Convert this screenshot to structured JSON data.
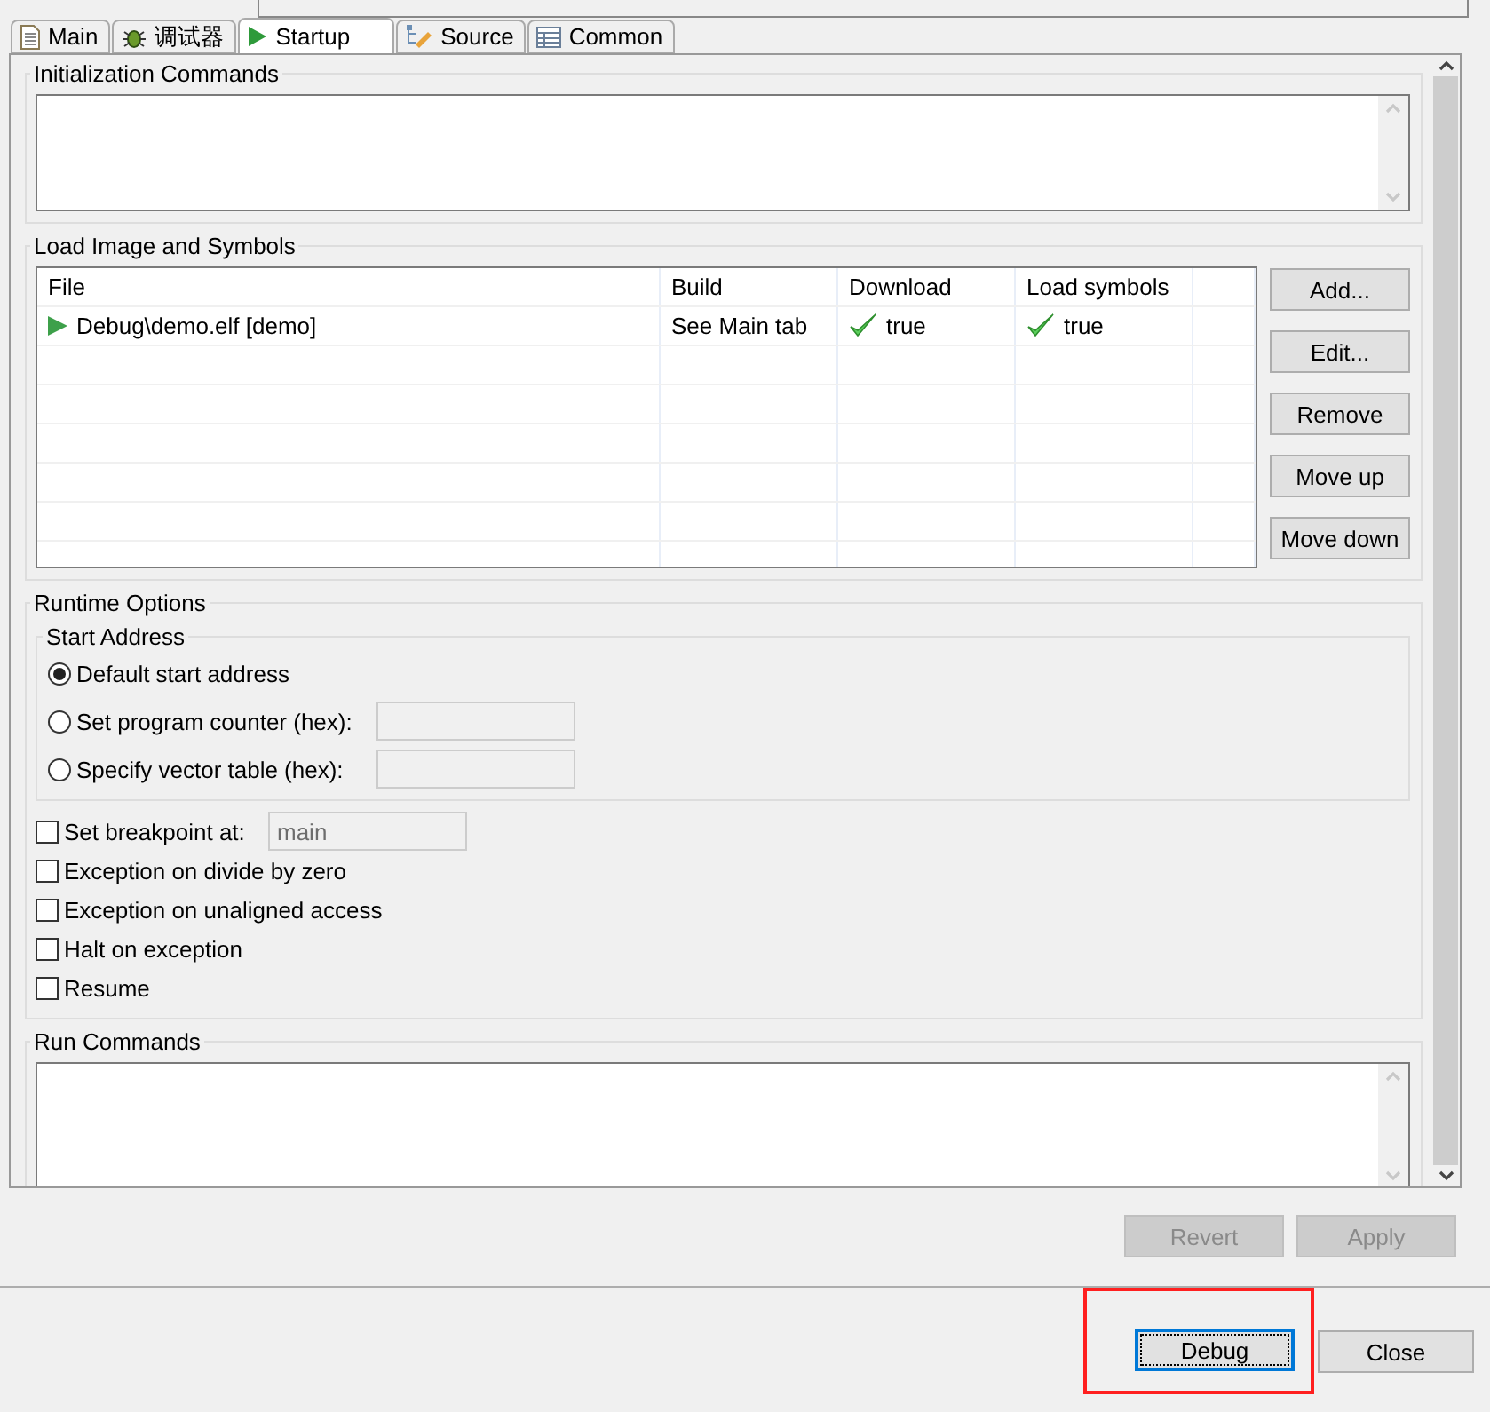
{
  "tabs": [
    {
      "label": "Main",
      "kind": "document",
      "selected": false
    },
    {
      "label": "调试器",
      "kind": "bug",
      "selected": false
    },
    {
      "label": "Startup",
      "kind": "play",
      "selected": true
    },
    {
      "label": "Source",
      "kind": "tree",
      "selected": false
    },
    {
      "label": "Common",
      "kind": "table",
      "selected": false
    }
  ],
  "init_commands": {
    "title": "Initialization Commands"
  },
  "load_image": {
    "title": "Load Image and Symbols",
    "columns": [
      "File",
      "Build",
      "Download",
      "Load symbols"
    ],
    "rows": [
      {
        "file": "Debug\\demo.elf [demo]",
        "build": "See Main tab",
        "download": "true",
        "load_symbols": "true"
      }
    ],
    "buttons": [
      "Add...",
      "Edit...",
      "Remove",
      "Move up",
      "Move down"
    ]
  },
  "runtime": {
    "title": "Runtime Options",
    "start_address": {
      "title": "Start Address",
      "options": [
        {
          "label": "Default start address",
          "selected": true,
          "kind": "plain"
        },
        {
          "label": "Set program counter (hex):",
          "selected": false,
          "kind": "address"
        },
        {
          "label": "Specify vector table (hex):",
          "selected": false,
          "kind": "address"
        }
      ]
    },
    "checks": [
      {
        "label": "Set breakpoint at:",
        "checked": false,
        "field": {
          "value": "main",
          "disabled": true
        }
      },
      {
        "label": "Exception on divide by zero",
        "checked": false
      },
      {
        "label": "Exception on unaligned access",
        "checked": false
      },
      {
        "label": "Halt on exception",
        "checked": false
      },
      {
        "label": "Resume",
        "checked": false
      }
    ]
  },
  "run_commands": {
    "title": "Run Commands"
  },
  "apply_buttons": [
    {
      "label": "Revert",
      "disabled": true
    },
    {
      "label": "Apply",
      "disabled": true
    }
  ],
  "dialog_buttons": [
    {
      "label": "Debug",
      "focused": true,
      "highlighted": true
    },
    {
      "label": "Close",
      "focused": false,
      "highlighted": false
    }
  ]
}
